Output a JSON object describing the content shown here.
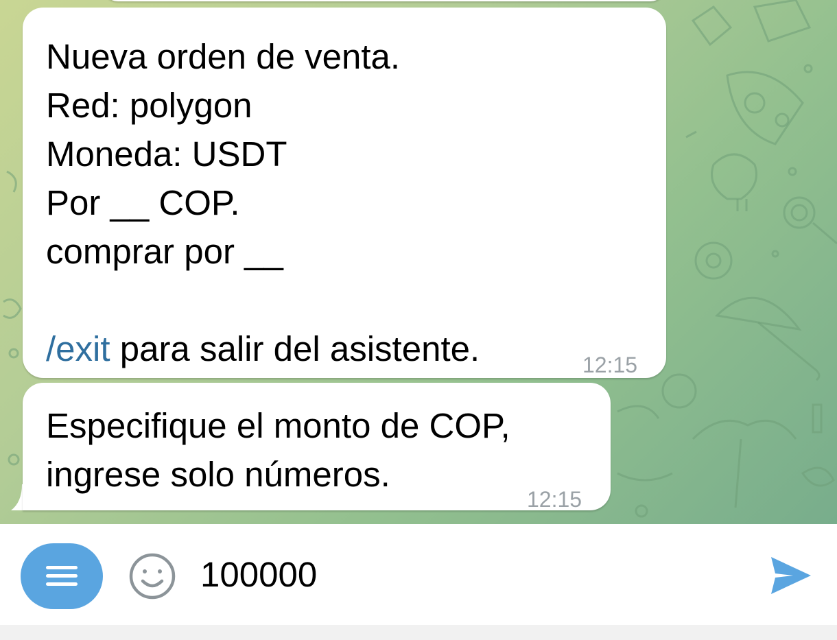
{
  "chat": {
    "messages": [
      {
        "lines": [
          "Nueva orden de venta.",
          "Red: polygon",
          "Moneda: USDT",
          "Por __ COP.",
          "comprar por __"
        ],
        "command": "/exit",
        "command_suffix": " para salir del asistente.",
        "time": "12:15"
      },
      {
        "lines": [
          "Especifique el monto de COP,",
          "ingrese solo números."
        ],
        "time": "12:15"
      }
    ]
  },
  "composer": {
    "menu_icon": "menu-icon",
    "emoji_icon": "smiley-icon",
    "input_value": "100000",
    "send_icon": "send-icon"
  },
  "colors": {
    "accent": "#5aa5e0",
    "link": "#2f6f9f",
    "timestamp": "#9aa1a6",
    "bubble": "#ffffff"
  }
}
